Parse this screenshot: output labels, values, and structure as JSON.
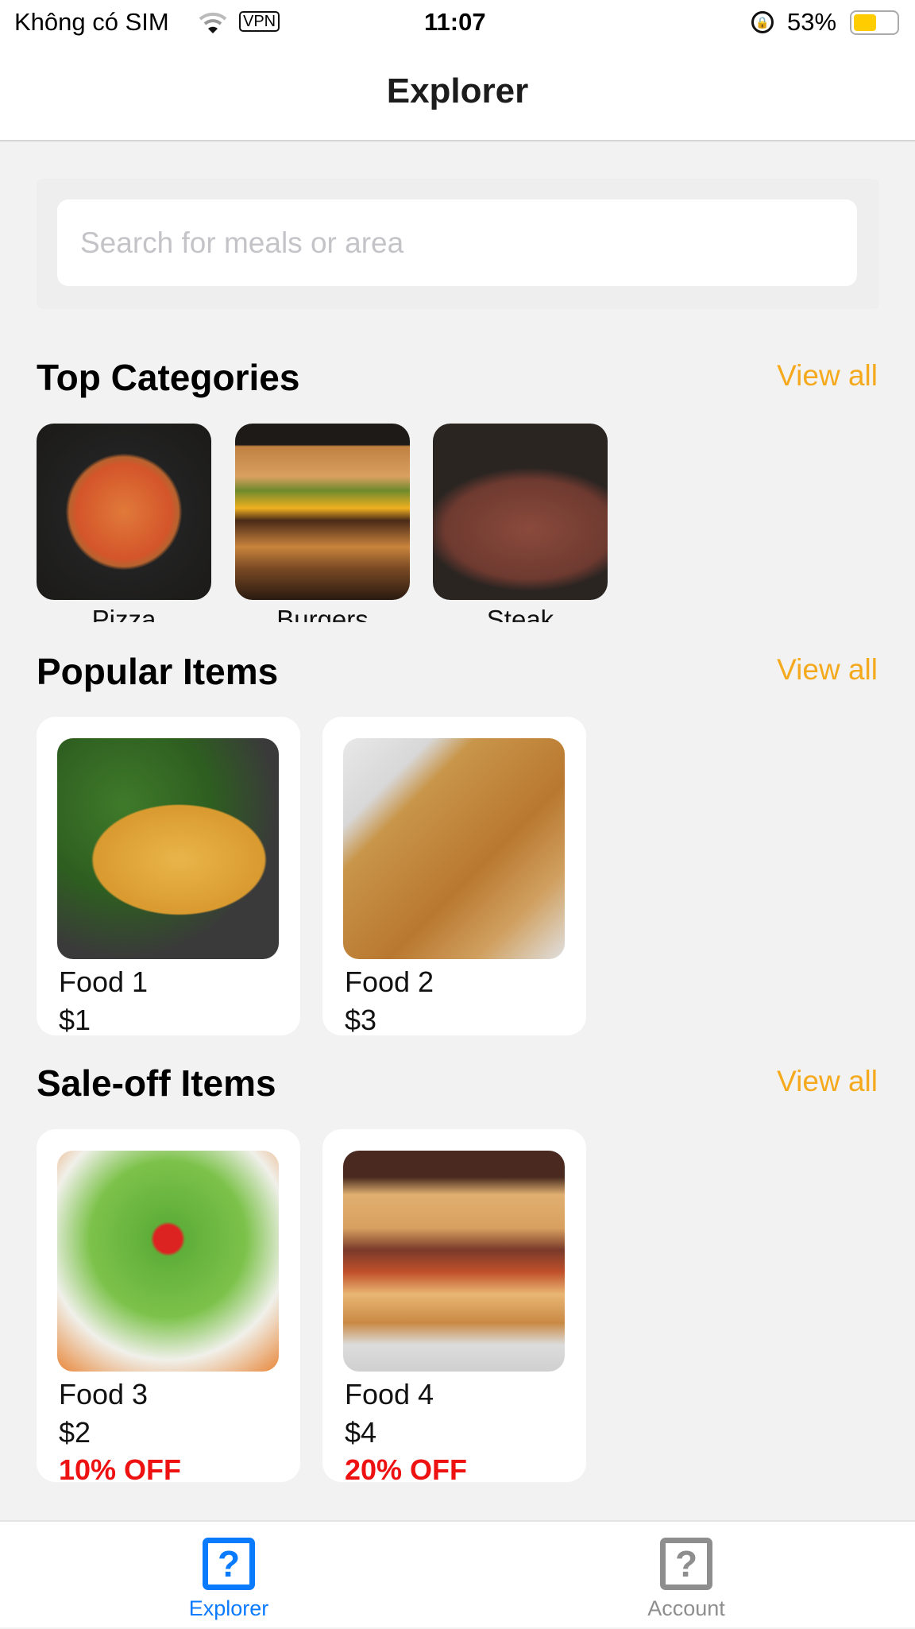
{
  "status": {
    "carrier": "Không có SIM",
    "vpn": "VPN",
    "time": "11:07",
    "battery": "53%",
    "battery_level": 0.53
  },
  "header": {
    "title": "Explorer"
  },
  "search": {
    "placeholder": "Search for meals or area",
    "value": ""
  },
  "top_categories": {
    "title": "Top Categories",
    "view_all": "View all",
    "items": [
      {
        "label": "Pizza"
      },
      {
        "label": "Burgers"
      },
      {
        "label": "Steak"
      }
    ]
  },
  "popular": {
    "title": "Popular Items",
    "view_all": "View all",
    "items": [
      {
        "name": "Food 1",
        "price": "$1"
      },
      {
        "name": "Food 2",
        "price": "$3"
      }
    ]
  },
  "sale": {
    "title": "Sale-off Items",
    "view_all": "View all",
    "items": [
      {
        "name": "Food 3",
        "price": "$2",
        "discount": "10% OFF"
      },
      {
        "name": "Food 4",
        "price": "$4",
        "discount": "20% OFF"
      }
    ]
  },
  "tabs": [
    {
      "label": "Explorer",
      "icon": "question-square-icon",
      "active": true
    },
    {
      "label": "Account",
      "icon": "question-square-icon",
      "active": false
    }
  ],
  "colors": {
    "accent": "#f5a91c",
    "tab_active": "#0a7aff",
    "tab_inactive": "#8e8e8e",
    "discount": "#ee1111"
  }
}
